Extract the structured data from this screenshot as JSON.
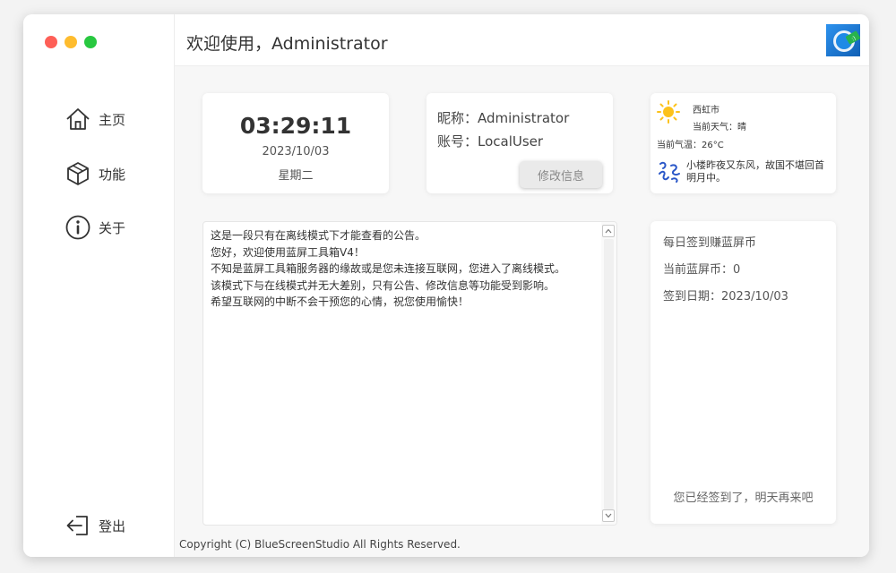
{
  "window": {
    "title": "欢迎使用，Administrator",
    "controls": {
      "close_color": "#fe5f57",
      "minimize_color": "#febc2e",
      "maximize_color": "#28c840"
    }
  },
  "sidebar": {
    "items": [
      {
        "label": "主页",
        "icon": "home-icon"
      },
      {
        "label": "功能",
        "icon": "cube-icon"
      },
      {
        "label": "关于",
        "icon": "info-icon"
      }
    ],
    "logout": {
      "label": "登出",
      "icon": "logout-icon"
    }
  },
  "clock": {
    "time": "03:29:11",
    "date": "2023/10/03",
    "weekday": "星期二"
  },
  "user": {
    "nickname_line": "昵称：Administrator",
    "account_line": "账号：LocalUser",
    "edit_button": "修改信息"
  },
  "weather": {
    "city": "西虹市",
    "condition": "当前天气：晴",
    "temperature": "当前气温：26°C",
    "quote": "小楼昨夜又东风，故国不堪回首明月中。",
    "icon": "sun-icon"
  },
  "notice": {
    "lines": [
      "这是一段只有在离线模式下才能查看的公告。",
      "您好，欢迎使用蓝屏工具箱V4！",
      "不知是蓝屏工具箱服务器的缘故或是您未连接互联网，您进入了离线模式。",
      "该模式下与在线模式并无大差别，只有公告、修改信息等功能受到影响。",
      "希望互联网的中断不会干预您的心情，祝您使用愉快！"
    ]
  },
  "signin": {
    "title": "每日签到赚蓝屏币",
    "coins": "当前蓝屏币：0",
    "date": "签到日期：2023/10/03",
    "status": "您已经签到了，明天再来吧"
  },
  "footer": {
    "copyright": "Copyright (C) BlueScreenStudio All Rights Reserved."
  }
}
